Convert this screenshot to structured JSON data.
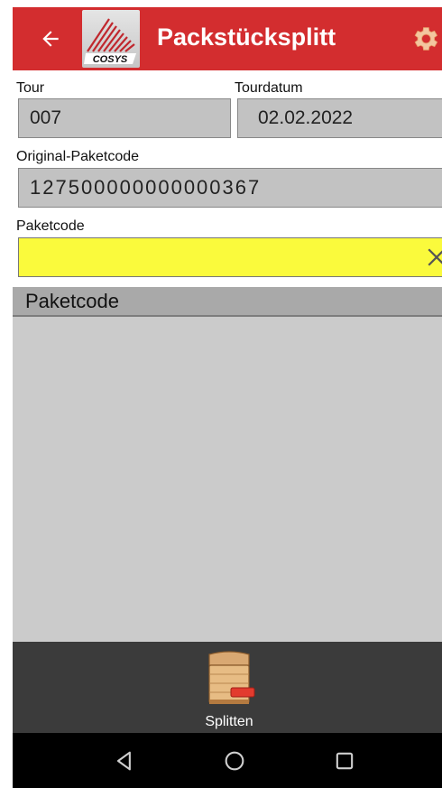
{
  "appbar": {
    "title": "Packstücksplitt",
    "logo_text": "COSYS",
    "back_icon": "arrow-left-icon",
    "settings_icon": "gear-icon",
    "color": "#d32d2f"
  },
  "form": {
    "tour_label": "Tour",
    "tour_value": "007",
    "tourdatum_label": "Tourdatum",
    "tourdatum_value": "02.02.2022",
    "original_label": "Original-Paketcode",
    "original_value": "127500000000000367",
    "paketcode_label": "Paketcode",
    "paketcode_value": "",
    "paketcode_bg": "#fafa3c",
    "clear_icon": "close-icon"
  },
  "list": {
    "header": "Paketcode",
    "rows": []
  },
  "toolbar": {
    "split_label": "Splitten",
    "split_icon": "crate-remove-icon"
  },
  "navbar": {
    "back_icon": "triangle-back-icon",
    "home_icon": "circle-home-icon",
    "recents_icon": "square-recents-icon"
  }
}
